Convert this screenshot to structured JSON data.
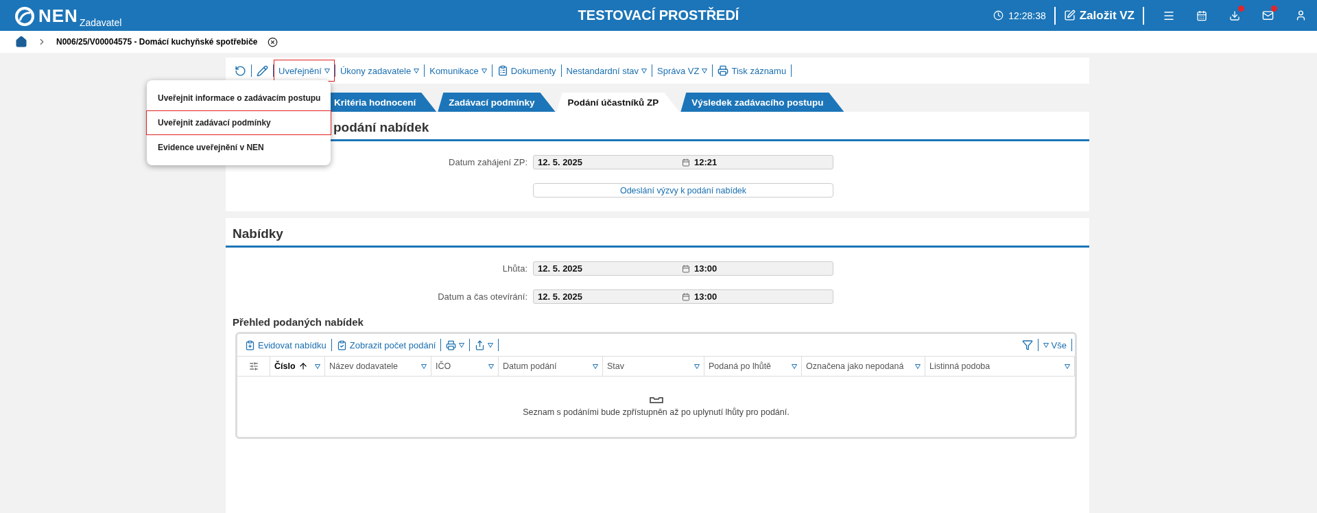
{
  "header": {
    "logo": "NEN",
    "logo_sub": "Zadavatel",
    "title": "TESTOVACÍ PROSTŘEDÍ",
    "time": "12:28:38",
    "create_button": "Založit VZ",
    "icons": [
      {
        "kind": "menu",
        "badge": false
      },
      {
        "kind": "calendar",
        "badge": false
      },
      {
        "kind": "download",
        "badge": true
      },
      {
        "kind": "mail",
        "badge": true
      },
      {
        "kind": "user",
        "badge": false
      }
    ]
  },
  "breadcrumb": {
    "title": "N006/25/V00004575 - Domácí kuchyňské spotřebiče"
  },
  "toolbar": [
    {
      "kind": "refresh"
    },
    {
      "kind": "edit"
    },
    {
      "kind": "dropdown",
      "label": "Uveřejnění",
      "expanded": true
    },
    {
      "kind": "dropdown",
      "label": "Úkony zadavatele",
      "expanded": false
    },
    {
      "kind": "dropdown",
      "label": "Komunikace",
      "expanded": false
    },
    {
      "kind": "documents",
      "label": "Dokumenty"
    },
    {
      "kind": "dropdown",
      "label": "Nestandardní stav",
      "expanded": false
    },
    {
      "kind": "dropdown",
      "label": "Správa VZ",
      "expanded": false
    },
    {
      "kind": "print",
      "label": "Tisk záznamu"
    }
  ],
  "menu": [
    {
      "label": "Uveřejnit informace o zadávacím postupu",
      "selected": false
    },
    {
      "label": "Uveřejnit zadávací podmínky",
      "selected": true
    },
    {
      "label": "Evidence uveřejnění v NEN",
      "selected": false
    }
  ],
  "tabs": [
    {
      "label": "Kritéria hodnocení",
      "selected": false
    },
    {
      "label": "Zadávací podmínky",
      "selected": false
    },
    {
      "label": "Podání účastníků ZP",
      "selected": true
    },
    {
      "label": "Výsledek zadávacího postupu",
      "selected": false
    }
  ],
  "start_section": {
    "title": "podání nabídek",
    "fields": [
      {
        "label": "Datum zahájení ZP:",
        "date": "12. 5. 2025",
        "time": "12:21"
      }
    ],
    "button": "Odeslání výzvy k podání nabídek"
  },
  "offers_section": {
    "title": "Nabídky",
    "fields": [
      {
        "label": "Lhůta:",
        "date": "12. 5. 2025",
        "time": "13:00"
      },
      {
        "label": "Datum a čas otevírání:",
        "date": "12. 5. 2025",
        "time": "13:00"
      }
    ],
    "subtitle": "Přehled podaných nabídek",
    "table": {
      "toolbar": [
        {
          "kind": "register",
          "label": "Evidovat nabídku"
        },
        {
          "kind": "count",
          "label": "Zobrazit počet podání"
        },
        {
          "kind": "print-menu"
        },
        {
          "kind": "export-menu"
        }
      ],
      "view": "Vše",
      "columns": [
        {
          "label": "Číslo",
          "sorted": true
        },
        {
          "label": "Název dodavatele",
          "sorted": false
        },
        {
          "label": "IČO",
          "sorted": false
        },
        {
          "label": "Datum podání",
          "sorted": false
        },
        {
          "label": "Stav",
          "sorted": false
        },
        {
          "label": "Podaná po lhůtě",
          "sorted": false
        },
        {
          "label": "Označena jako nepodaná",
          "sorted": false
        },
        {
          "label": "Listinná podoba",
          "sorted": false
        }
      ],
      "empty_message": "Seznam s podáními bude zpřístupněn až po uplynutí lhůty pro podání."
    }
  }
}
